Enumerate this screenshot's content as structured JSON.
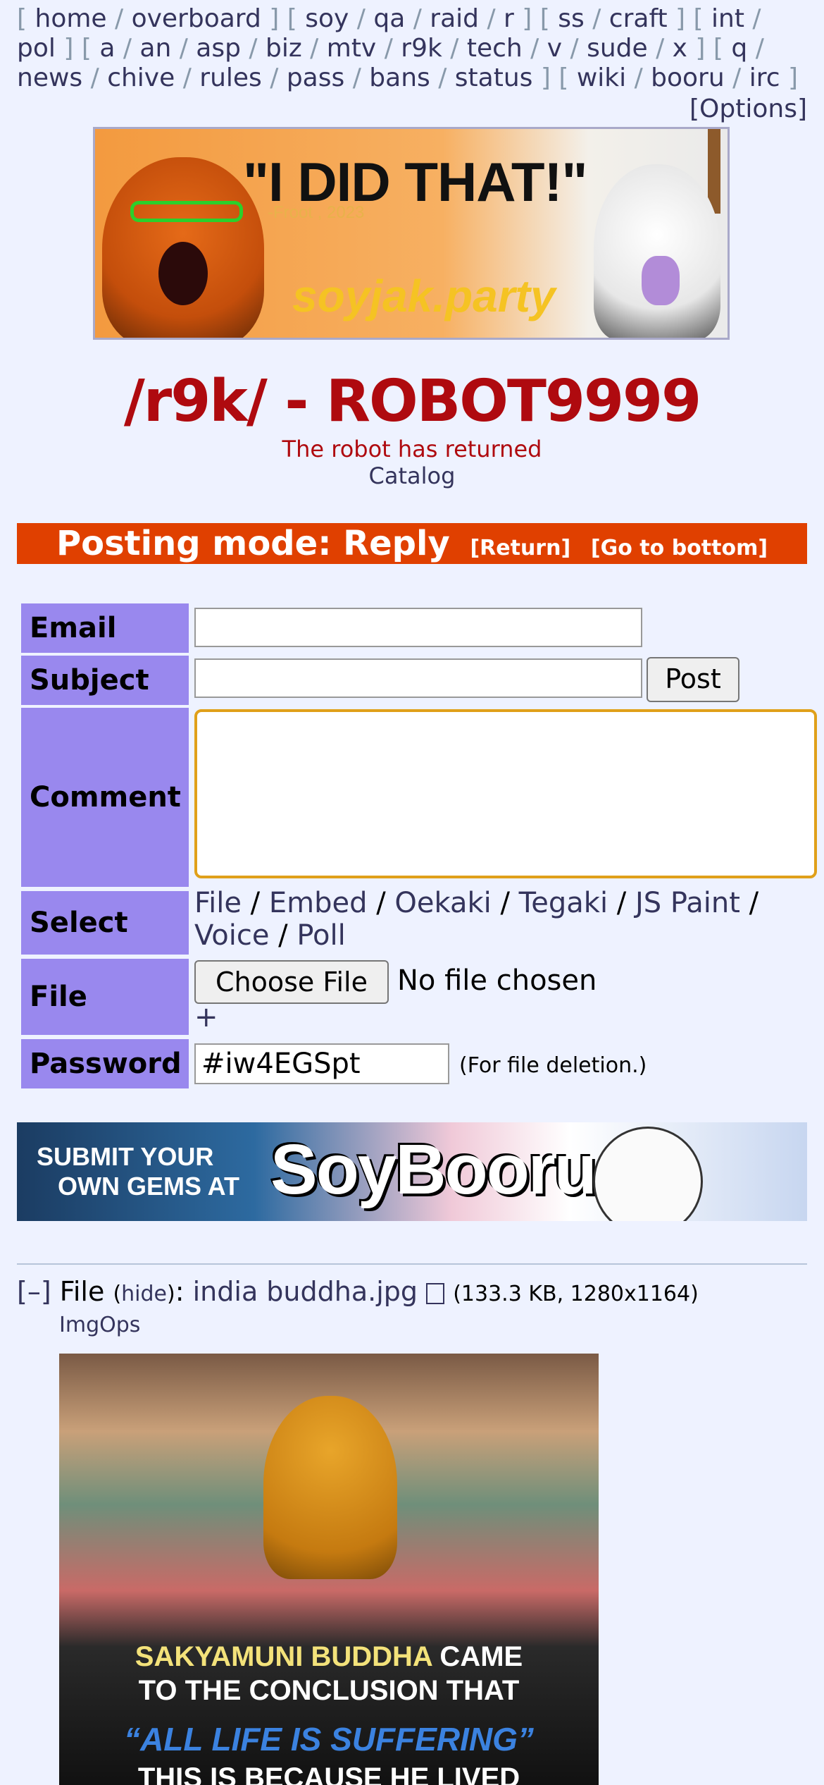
{
  "boardlist": {
    "line1": [
      "home",
      "overboard",
      "soy",
      "qa",
      "raid",
      "r",
      "ss",
      "craft",
      "int"
    ],
    "line2": [
      "pol",
      "a",
      "an",
      "asp",
      "biz",
      "mtv",
      "r9k",
      "tech",
      "v",
      "sude",
      "x",
      "q"
    ],
    "line3": [
      "news",
      "chive",
      "rules",
      "pass",
      "bans",
      "status",
      "wiki",
      "booru",
      "irc"
    ],
    "options": "[Options]"
  },
  "banner": {
    "quote": "\"I DID THAT!\"",
    "signature": "-Froot , 2023",
    "site": "soyjak.party"
  },
  "board": {
    "title": "/r9k/ - ROBOT9999",
    "subtitle": "The robot has returned",
    "catalog": "Catalog"
  },
  "posting_mode": {
    "label": "Posting mode: Reply",
    "return": "[Return]",
    "go_bottom": "[Go to bottom]"
  },
  "form": {
    "email_label": "Email",
    "email_value": "",
    "subject_label": "Subject",
    "subject_value": "",
    "post_button": "Post",
    "comment_label": "Comment",
    "comment_value": "",
    "select_label": "Select",
    "select_options": [
      "File",
      "Embed",
      "Oekaki",
      "Tegaki",
      "JS Paint",
      "Voice",
      "Poll"
    ],
    "file_label": "File",
    "choose_file": "Choose File",
    "no_file": "No file chosen",
    "add_more": "+",
    "password_label": "Password",
    "password_value": "#iw4EGSpt",
    "password_hint": "(For file deletion.)"
  },
  "ad": {
    "line1": "SUBMIT YOUR",
    "line2": "OWN GEMS AT",
    "brand": "SoyBooru"
  },
  "post": {
    "collapse": "[–]",
    "file_word": "File",
    "hide": "hide",
    "filename": "india buddha.jpg",
    "meta": "(133.3 KB, 1280x1164)",
    "imgops": "ImgOps",
    "image_text": {
      "l1a": "SAKYAMUNI BUDDHA",
      "l1b": " CAME",
      "l2": "TO THE CONCLUSION THAT",
      "l3": "“ALL LIFE IS SUFFERING”",
      "l4": "THIS IS BECAUSE HE LIVED"
    }
  },
  "colors": {
    "background": "#eef2ff",
    "accent_red": "#af0a0f",
    "postmode_bar": "#e04000",
    "label_bg": "#9988ee",
    "link": "#34345c"
  }
}
